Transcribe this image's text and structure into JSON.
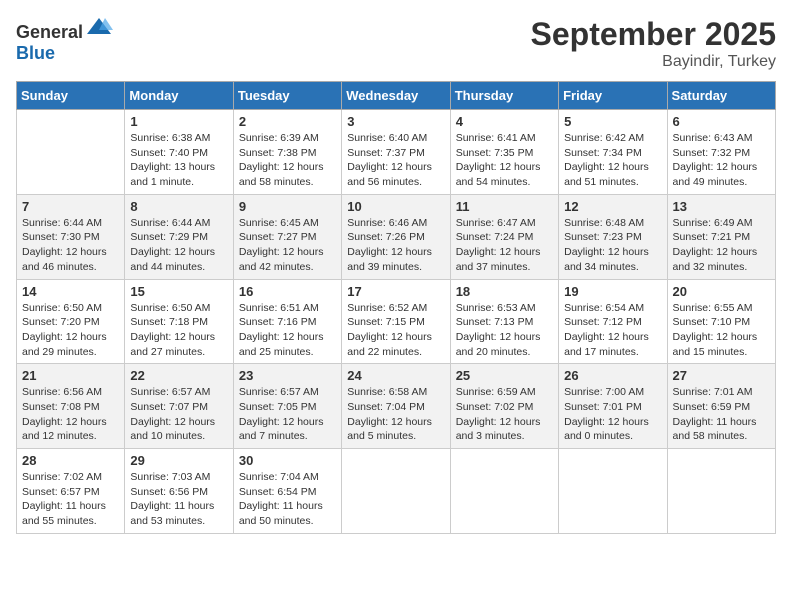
{
  "logo": {
    "text_general": "General",
    "text_blue": "Blue"
  },
  "title": {
    "month": "September 2025",
    "location": "Bayindir, Turkey"
  },
  "headers": [
    "Sunday",
    "Monday",
    "Tuesday",
    "Wednesday",
    "Thursday",
    "Friday",
    "Saturday"
  ],
  "weeks": [
    [
      {
        "day": "",
        "info": ""
      },
      {
        "day": "1",
        "info": "Sunrise: 6:38 AM\nSunset: 7:40 PM\nDaylight: 13 hours\nand 1 minute."
      },
      {
        "day": "2",
        "info": "Sunrise: 6:39 AM\nSunset: 7:38 PM\nDaylight: 12 hours\nand 58 minutes."
      },
      {
        "day": "3",
        "info": "Sunrise: 6:40 AM\nSunset: 7:37 PM\nDaylight: 12 hours\nand 56 minutes."
      },
      {
        "day": "4",
        "info": "Sunrise: 6:41 AM\nSunset: 7:35 PM\nDaylight: 12 hours\nand 54 minutes."
      },
      {
        "day": "5",
        "info": "Sunrise: 6:42 AM\nSunset: 7:34 PM\nDaylight: 12 hours\nand 51 minutes."
      },
      {
        "day": "6",
        "info": "Sunrise: 6:43 AM\nSunset: 7:32 PM\nDaylight: 12 hours\nand 49 minutes."
      }
    ],
    [
      {
        "day": "7",
        "info": "Sunrise: 6:44 AM\nSunset: 7:30 PM\nDaylight: 12 hours\nand 46 minutes."
      },
      {
        "day": "8",
        "info": "Sunrise: 6:44 AM\nSunset: 7:29 PM\nDaylight: 12 hours\nand 44 minutes."
      },
      {
        "day": "9",
        "info": "Sunrise: 6:45 AM\nSunset: 7:27 PM\nDaylight: 12 hours\nand 42 minutes."
      },
      {
        "day": "10",
        "info": "Sunrise: 6:46 AM\nSunset: 7:26 PM\nDaylight: 12 hours\nand 39 minutes."
      },
      {
        "day": "11",
        "info": "Sunrise: 6:47 AM\nSunset: 7:24 PM\nDaylight: 12 hours\nand 37 minutes."
      },
      {
        "day": "12",
        "info": "Sunrise: 6:48 AM\nSunset: 7:23 PM\nDaylight: 12 hours\nand 34 minutes."
      },
      {
        "day": "13",
        "info": "Sunrise: 6:49 AM\nSunset: 7:21 PM\nDaylight: 12 hours\nand 32 minutes."
      }
    ],
    [
      {
        "day": "14",
        "info": "Sunrise: 6:50 AM\nSunset: 7:20 PM\nDaylight: 12 hours\nand 29 minutes."
      },
      {
        "day": "15",
        "info": "Sunrise: 6:50 AM\nSunset: 7:18 PM\nDaylight: 12 hours\nand 27 minutes."
      },
      {
        "day": "16",
        "info": "Sunrise: 6:51 AM\nSunset: 7:16 PM\nDaylight: 12 hours\nand 25 minutes."
      },
      {
        "day": "17",
        "info": "Sunrise: 6:52 AM\nSunset: 7:15 PM\nDaylight: 12 hours\nand 22 minutes."
      },
      {
        "day": "18",
        "info": "Sunrise: 6:53 AM\nSunset: 7:13 PM\nDaylight: 12 hours\nand 20 minutes."
      },
      {
        "day": "19",
        "info": "Sunrise: 6:54 AM\nSunset: 7:12 PM\nDaylight: 12 hours\nand 17 minutes."
      },
      {
        "day": "20",
        "info": "Sunrise: 6:55 AM\nSunset: 7:10 PM\nDaylight: 12 hours\nand 15 minutes."
      }
    ],
    [
      {
        "day": "21",
        "info": "Sunrise: 6:56 AM\nSunset: 7:08 PM\nDaylight: 12 hours\nand 12 minutes."
      },
      {
        "day": "22",
        "info": "Sunrise: 6:57 AM\nSunset: 7:07 PM\nDaylight: 12 hours\nand 10 minutes."
      },
      {
        "day": "23",
        "info": "Sunrise: 6:57 AM\nSunset: 7:05 PM\nDaylight: 12 hours\nand 7 minutes."
      },
      {
        "day": "24",
        "info": "Sunrise: 6:58 AM\nSunset: 7:04 PM\nDaylight: 12 hours\nand 5 minutes."
      },
      {
        "day": "25",
        "info": "Sunrise: 6:59 AM\nSunset: 7:02 PM\nDaylight: 12 hours\nand 3 minutes."
      },
      {
        "day": "26",
        "info": "Sunrise: 7:00 AM\nSunset: 7:01 PM\nDaylight: 12 hours\nand 0 minutes."
      },
      {
        "day": "27",
        "info": "Sunrise: 7:01 AM\nSunset: 6:59 PM\nDaylight: 11 hours\nand 58 minutes."
      }
    ],
    [
      {
        "day": "28",
        "info": "Sunrise: 7:02 AM\nSunset: 6:57 PM\nDaylight: 11 hours\nand 55 minutes."
      },
      {
        "day": "29",
        "info": "Sunrise: 7:03 AM\nSunset: 6:56 PM\nDaylight: 11 hours\nand 53 minutes."
      },
      {
        "day": "30",
        "info": "Sunrise: 7:04 AM\nSunset: 6:54 PM\nDaylight: 11 hours\nand 50 minutes."
      },
      {
        "day": "",
        "info": ""
      },
      {
        "day": "",
        "info": ""
      },
      {
        "day": "",
        "info": ""
      },
      {
        "day": "",
        "info": ""
      }
    ]
  ]
}
